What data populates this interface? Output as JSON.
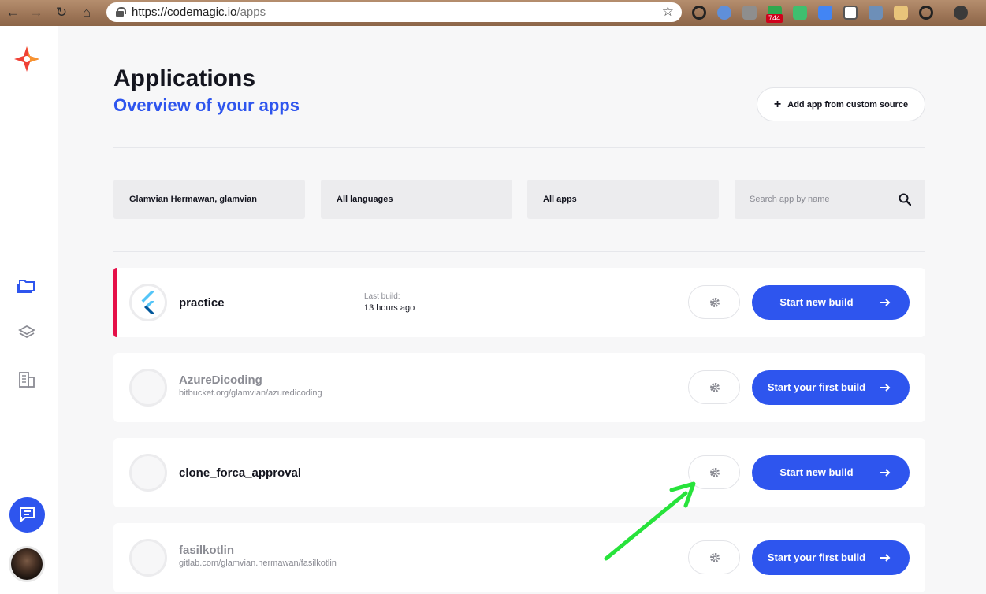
{
  "browser": {
    "url_host": "https://codemagic.io",
    "url_path": "/apps",
    "badge_count": "744"
  },
  "colors": {
    "accent": "#2e55ee",
    "active_marker": "#e50f48",
    "annotation_arrow": "#27e33b"
  },
  "page": {
    "title": "Applications",
    "subtitle": "Overview of your apps",
    "add_button_label": "Add app from custom source"
  },
  "filters": {
    "account": "Glamvian Hermawan, glamvian",
    "language": "All languages",
    "apps": "All apps",
    "search_placeholder": "Search app by name"
  },
  "apps": [
    {
      "name": "practice",
      "last_build_label": "Last build:",
      "last_build_value": "13 hours ago",
      "button_label": "Start new build"
    },
    {
      "name": "AzureDicoding",
      "repo": "bitbucket.org/glamvian/azuredicoding",
      "button_label": "Start your first build"
    },
    {
      "name": "clone_forca_approval",
      "button_label": "Start new build"
    },
    {
      "name": "fasilkotlin",
      "repo": "gitlab.com/glamvian.hermawan/fasilkotlin",
      "button_label": "Start your first build"
    }
  ]
}
